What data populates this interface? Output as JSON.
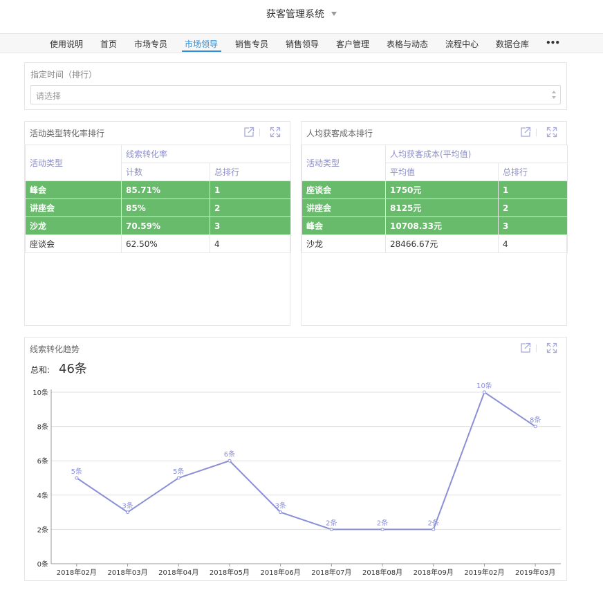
{
  "app": {
    "title": "获客管理系统"
  },
  "nav": {
    "items": [
      "使用说明",
      "首页",
      "市场专员",
      "市场领导",
      "销售专员",
      "销售领导",
      "客户管理",
      "表格与动态",
      "流程中心",
      "数据仓库"
    ],
    "more": "•••",
    "active_index": 3
  },
  "filter": {
    "label": "指定时间（排行）",
    "placeholder": "请选择"
  },
  "activity_table": {
    "title": "活动类型转化率排行",
    "col_type": "活动类型",
    "group_header": "线索转化率",
    "col_count": "计数",
    "col_rank": "总排行",
    "rows": [
      {
        "type": "峰会",
        "value": "85.71%",
        "rank": "1",
        "highlight": true
      },
      {
        "type": "讲座会",
        "value": "85%",
        "rank": "2",
        "highlight": true
      },
      {
        "type": "沙龙",
        "value": "70.59%",
        "rank": "3",
        "highlight": true
      },
      {
        "type": "座谈会",
        "value": "62.50%",
        "rank": "4",
        "highlight": false
      }
    ]
  },
  "cost_table": {
    "title": "人均获客成本排行",
    "col_type": "活动类型",
    "group_header": "人均获客成本(平均值)",
    "col_avg": "平均值",
    "col_rank": "总排行",
    "rows": [
      {
        "type": "座谈会",
        "value": "1750元",
        "rank": "1",
        "highlight": true
      },
      {
        "type": "讲座会",
        "value": "8125元",
        "rank": "2",
        "highlight": true
      },
      {
        "type": "峰会",
        "value": "10708.33元",
        "rank": "3",
        "highlight": true
      },
      {
        "type": "沙龙",
        "value": "28466.67元",
        "rank": "4",
        "highlight": false
      }
    ]
  },
  "trend_panel": {
    "title": "线索转化趋势",
    "sum_label": "总和:",
    "sum_value": "46条"
  },
  "colors": {
    "accent": "#2c8ed7",
    "highlight_row": "#67bb6a",
    "series_line": "#8a8fd6",
    "header_text": "#8d8fc9"
  },
  "icons": [
    "external-link-icon",
    "expand-icon"
  ],
  "chart_data": {
    "type": "line",
    "title": "线索转化趋势",
    "categories": [
      "2018年02月",
      "2018年03月",
      "2018年04月",
      "2018年05月",
      "2018年06月",
      "2018年07月",
      "2018年08月",
      "2018年09月",
      "2019年02月",
      "2019年03月"
    ],
    "series": [
      {
        "values": [
          5,
          3,
          5,
          6,
          3,
          2,
          2,
          2,
          10,
          8
        ]
      }
    ],
    "data_labels": [
      "5条",
      "3条",
      "5条",
      "6条",
      "3条",
      "2条",
      "2条",
      "2条",
      "10条",
      "8条"
    ],
    "y_ticks": [
      "0条",
      "2条",
      "4条",
      "6条",
      "8条",
      "10条"
    ],
    "ylim": [
      0,
      10
    ],
    "grid": true
  }
}
